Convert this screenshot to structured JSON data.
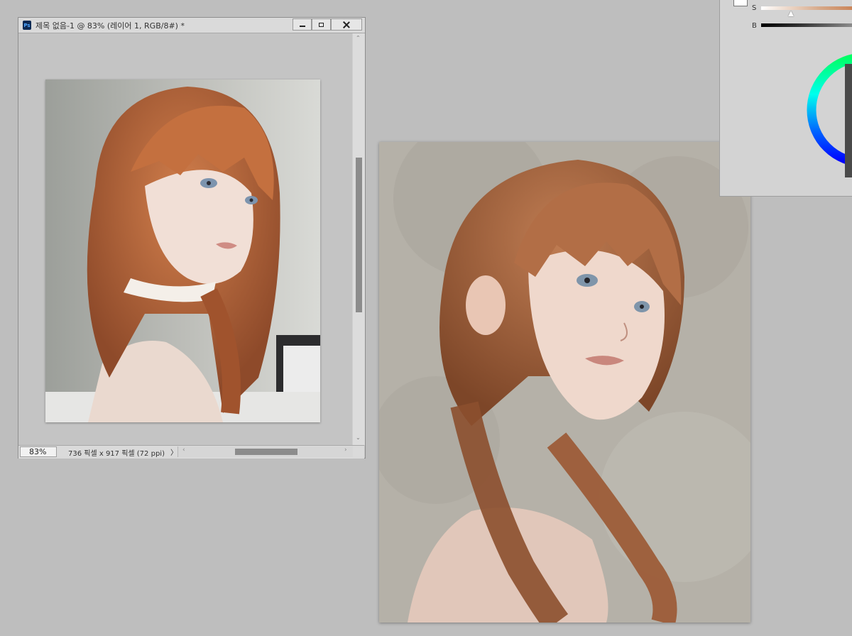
{
  "document_window": {
    "app_icon_text": "Ps",
    "title": "제목 없음-1 @ 83% (레이어 1, RGB/8#) *",
    "status_zoom": "83%",
    "status_info": "736 픽셀 x 917 픽셀 (72 ppi)",
    "status_arrow": "〉"
  },
  "color_panel": {
    "saturation_label": "S",
    "brightness_label": "B",
    "saturation_value": 0.24
  },
  "colors": {
    "app_background": "#bebebe",
    "window_chrome": "#dadada",
    "hair": "#b46a42",
    "skin": "#ecd6cb",
    "eyes": "#7d94ae"
  }
}
